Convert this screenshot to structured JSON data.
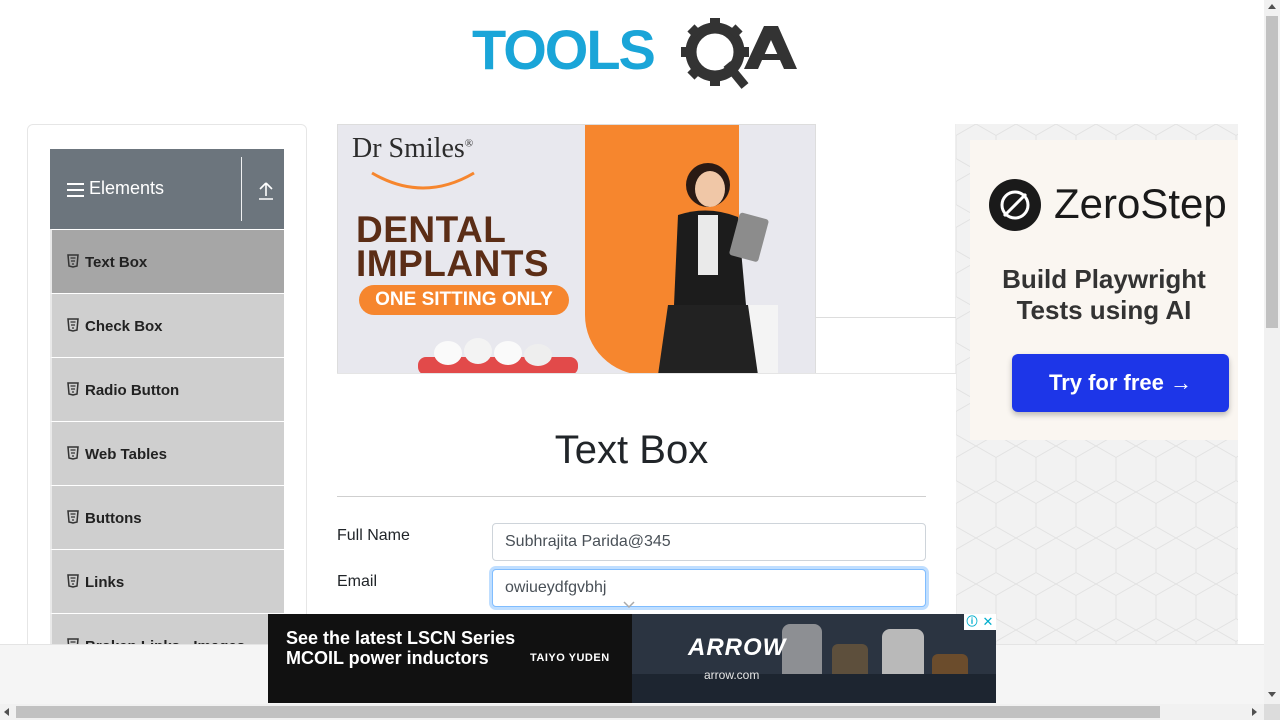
{
  "header": {
    "logo_text": "TOOLSQA"
  },
  "sidebar": {
    "group_title": "Elements",
    "items": [
      {
        "label": "Text Box",
        "active": true
      },
      {
        "label": "Check Box"
      },
      {
        "label": "Radio Button"
      },
      {
        "label": "Web Tables"
      },
      {
        "label": "Buttons"
      },
      {
        "label": "Links"
      },
      {
        "label": "Broken Links - Images"
      }
    ]
  },
  "banner_ad": {
    "brand": "Dr Smiles",
    "registered": "®",
    "headline_1": "DENTAL",
    "headline_2": "IMPLANTS",
    "cta": "ONE SITTING ONLY"
  },
  "main": {
    "title": "Text Box",
    "fields": {
      "full_name": {
        "label": "Full Name",
        "value": "Subhrajita Parida@345"
      },
      "email": {
        "label": "Email",
        "value": "owiueydfgvbhj"
      }
    }
  },
  "right_ad": {
    "brand": "ZeroStep",
    "tagline_1": "Build Playwright",
    "tagline_2": "Tests using AI",
    "button": "Try for free →"
  },
  "bottom_ad": {
    "headline": "See the latest LSCN Series MCOIL power inductors",
    "sponsor": "TAIYO YUDEN",
    "logo": "ARROW",
    "url": "arrow.com",
    "info_icon": "ⓘ",
    "close_icon": "✕"
  },
  "colors": {
    "sidebar_header": "#6c757d",
    "menu_item": "#cfcfcf",
    "menu_item_active": "#a6a6a6",
    "zerostep_button": "#1d36e8",
    "focus_border": "#80bdff"
  }
}
